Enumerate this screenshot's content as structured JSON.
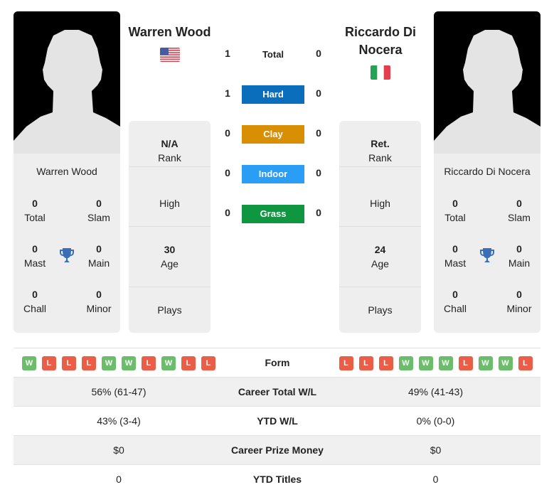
{
  "player1": {
    "name": "Warren Wood",
    "flag_icon": "usa-flag-icon",
    "card_name": "Warren Wood",
    "titles": [
      {
        "value": "0",
        "label": "Total"
      },
      {
        "value": "0",
        "label": "Slam"
      },
      {
        "value": "0",
        "label": "Mast"
      },
      {
        "value": "0",
        "label": "Main"
      },
      {
        "value": "0",
        "label": "Chall"
      },
      {
        "value": "0",
        "label": "Minor"
      }
    ],
    "info": [
      {
        "value": "N/A",
        "label": "Rank"
      },
      {
        "value": "",
        "label": "High"
      },
      {
        "value": "30",
        "label": "Age"
      },
      {
        "value": "",
        "label": "Plays"
      }
    ],
    "form": [
      "W",
      "L",
      "L",
      "L",
      "W",
      "W",
      "L",
      "W",
      "L",
      "L"
    ]
  },
  "player2": {
    "name_line1": "Riccardo Di",
    "name_line2": "Nocera",
    "flag_icon": "italy-flag-icon",
    "card_name": "Riccardo Di Nocera",
    "titles": [
      {
        "value": "0",
        "label": "Total"
      },
      {
        "value": "0",
        "label": "Slam"
      },
      {
        "value": "0",
        "label": "Mast"
      },
      {
        "value": "0",
        "label": "Main"
      },
      {
        "value": "0",
        "label": "Chall"
      },
      {
        "value": "0",
        "label": "Minor"
      }
    ],
    "info": [
      {
        "value": "Ret.",
        "label": "Rank"
      },
      {
        "value": "",
        "label": "High"
      },
      {
        "value": "24",
        "label": "Age"
      },
      {
        "value": "",
        "label": "Plays"
      }
    ],
    "form": [
      "L",
      "L",
      "L",
      "W",
      "W",
      "W",
      "L",
      "W",
      "W",
      "L"
    ]
  },
  "h2h": [
    {
      "label": "Total",
      "p1": "1",
      "p2": "0",
      "color": null
    },
    {
      "label": "Hard",
      "p1": "1",
      "p2": "0",
      "color": "#0a6ebd"
    },
    {
      "label": "Clay",
      "p1": "0",
      "p2": "0",
      "color": "#d98f04"
    },
    {
      "label": "Indoor",
      "p1": "0",
      "p2": "0",
      "color": "#2a9df4"
    },
    {
      "label": "Grass",
      "p1": "0",
      "p2": "0",
      "color": "#0f9640"
    }
  ],
  "table": {
    "form_label": "Form",
    "rows": [
      {
        "label": "Career Total W/L",
        "p1": "56% (61-47)",
        "p2": "49% (41-43)"
      },
      {
        "label": "YTD W/L",
        "p1": "43% (3-4)",
        "p2": "0% (0-0)"
      },
      {
        "label": "Career Prize Money",
        "p1": "$0",
        "p2": "$0"
      },
      {
        "label": "YTD Titles",
        "p1": "0",
        "p2": "0"
      }
    ]
  },
  "colors": {
    "win": "#6cbd6b",
    "loss": "#ea5d46",
    "trophy": "#3a6fb8"
  }
}
